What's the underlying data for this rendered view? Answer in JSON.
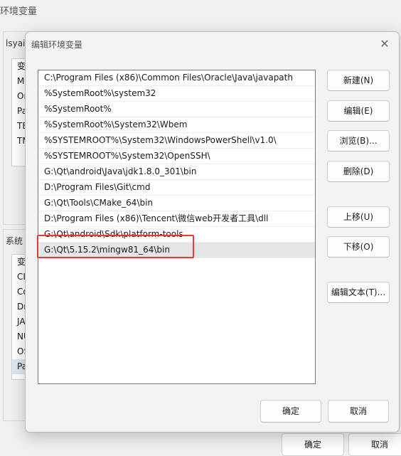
{
  "background": {
    "title": "环境变量",
    "user_group_label": "lsyai",
    "user_rows": [
      "变",
      "M",
      "Or",
      "Pa",
      "TE",
      "TM"
    ],
    "system_group_label": "系统",
    "system_rows": [
      "变",
      "CL",
      "Co",
      "Dr",
      "JA",
      "NU",
      "OS",
      "Pa"
    ],
    "ok_label": "确定",
    "cancel_label": "取消"
  },
  "dialog": {
    "title": "编辑环境变量",
    "close_glyph": "✕",
    "paths": [
      "C:\\Program Files (x86)\\Common Files\\Oracle\\Java\\javapath",
      "%SystemRoot%\\system32",
      "%SystemRoot%",
      "%SystemRoot%\\System32\\Wbem",
      "%SYSTEMROOT%\\System32\\WindowsPowerShell\\v1.0\\",
      "%SYSTEMROOT%\\System32\\OpenSSH\\",
      "G:\\Qt\\android\\Java\\jdk1.8.0_301\\bin",
      "D:\\Program Files\\Git\\cmd",
      "G:\\Qt\\Tools\\CMake_64\\bin",
      "D:\\Program Files (x86)\\Tencent\\微信web开发者工具\\dll",
      "G:\\Qt\\android\\Sdk\\platform-tools",
      "G:\\Qt\\5.15.2\\mingw81_64\\bin"
    ],
    "selected_index": 11,
    "buttons": {
      "new": "新建(N)",
      "edit": "编辑(E)",
      "browse": "浏览(B)...",
      "delete": "删除(D)",
      "move_up": "上移(U)",
      "move_down": "下移(O)",
      "edit_text": "编辑文本(T)...",
      "ok": "确定",
      "cancel": "取消"
    },
    "highlight_color": "#e53935"
  }
}
